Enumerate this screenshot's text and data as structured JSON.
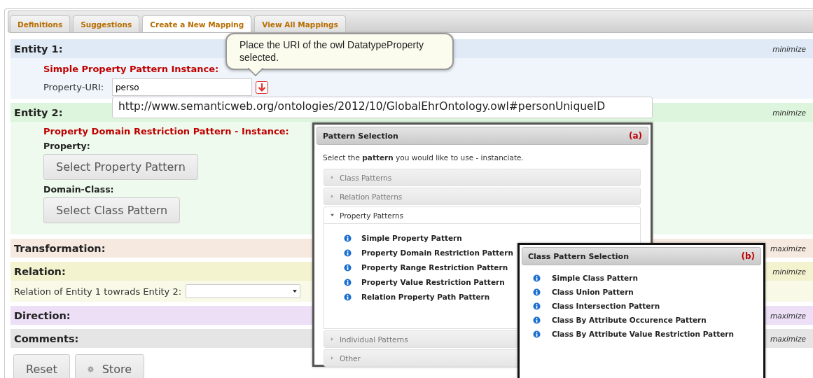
{
  "tabs": [
    {
      "label": "Definitions",
      "selected": false
    },
    {
      "label": "Suggestions",
      "selected": false
    },
    {
      "label": "Create a New Mapping",
      "selected": true
    },
    {
      "label": "View All Mappings",
      "selected": false
    }
  ],
  "tooltip": {
    "text": "Place the URI of the owl DatatypeProperty selected."
  },
  "sections": [
    {
      "kind": "entity1",
      "title": "Entity 1:",
      "action": "minimize",
      "expanded": true,
      "color": "#dfeaf6",
      "pattern_title": "Simple Property Pattern Instance:",
      "uri_label": "Property-URI:",
      "uri_value": "perso",
      "suggestion": "http://www.semanticweb.org/ontologies/2012/10/GlobalEhrOntology.owl#personUniqueID"
    },
    {
      "kind": "entity2",
      "title": "Entity 2:",
      "action": "minimize",
      "expanded": true,
      "color": "#dcf5dc",
      "pattern_title": "Property Domain Restriction Pattern - Instance:",
      "fields": [
        {
          "label": "Property:",
          "button": "Select Property Pattern"
        },
        {
          "label": "Domain-Class:",
          "button": "Select Class Pattern"
        }
      ]
    },
    {
      "title": "Transformation:",
      "action": "maximize",
      "expanded": false,
      "color": "#f6e9df"
    },
    {
      "kind": "relation",
      "title": "Relation:",
      "action": "minimize",
      "expanded": true,
      "color": "#f3f3cf",
      "label": "Relation of Entity 1 towrads Entity 2:"
    },
    {
      "title": "Direction:",
      "action": "maximize",
      "expanded": false,
      "color": "#ecdff6"
    },
    {
      "title": "Comments:",
      "action": "maximize",
      "expanded": false,
      "color": "#e5e5e5"
    }
  ],
  "buttons": [
    {
      "label": "Reset",
      "kind": "plain"
    },
    {
      "label": "Store",
      "kind": "gear"
    }
  ],
  "pattern_window": {
    "title": "Pattern Selection",
    "marker": "(a)",
    "intro": "Select the **pattern** you would like to use - instanciate.",
    "groups": [
      {
        "label": "Class Patterns",
        "expanded": false
      },
      {
        "label": "Relation Patterns",
        "expanded": false
      },
      {
        "label": "Property Patterns",
        "expanded": true,
        "items": [
          "Simple Property Pattern",
          "Property Domain Restriction Pattern",
          "Property Range Restriction Pattern",
          "Property Value Restriction Pattern",
          "Relation Property Path Pattern"
        ]
      },
      {
        "label": "Individual Patterns",
        "expanded": false
      },
      {
        "label": "Other",
        "expanded": false
      }
    ]
  },
  "class_window": {
    "title": "Class Pattern Selection",
    "marker": "(b)",
    "items": [
      "Simple Class Pattern",
      "Class Union Pattern",
      "Class Intersection Pattern",
      "Class By Attribute Occurence Pattern",
      "Class By Attribute Value Restriction Pattern"
    ]
  }
}
